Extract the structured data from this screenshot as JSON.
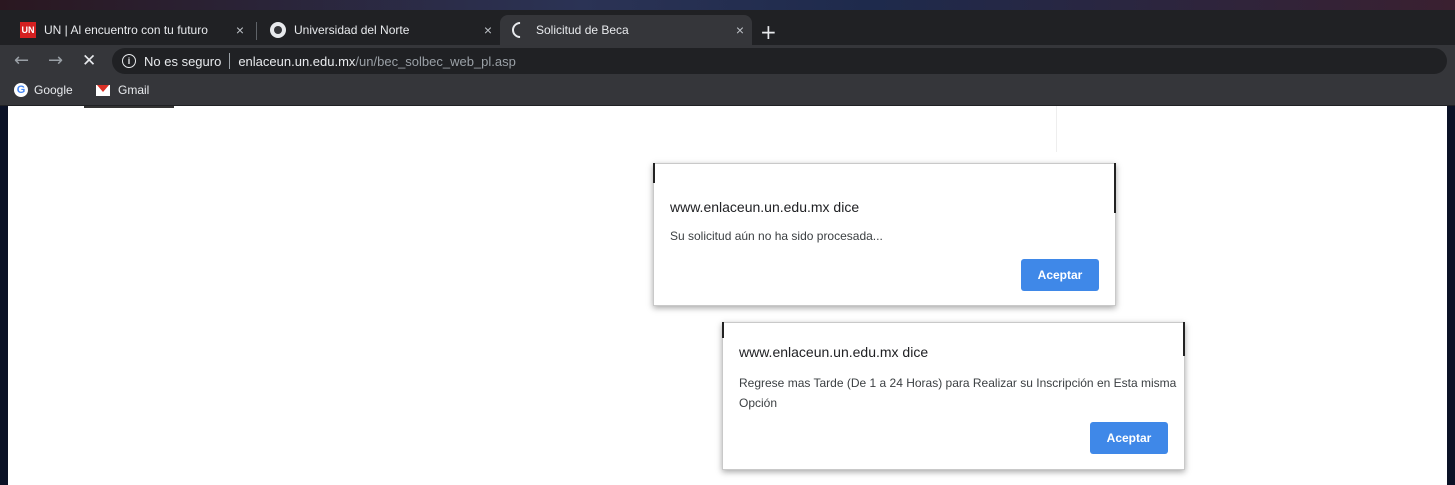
{
  "browser": {
    "tabs": [
      {
        "title": "UN | Al encuentro con tu futuro",
        "favicon": "university-red-icon",
        "active": false
      },
      {
        "title": "Universidad del Norte",
        "favicon": "globe-icon",
        "active": false
      },
      {
        "title": "Solicitud de Beca",
        "favicon": "loading-spinner-icon",
        "active": true
      }
    ],
    "close_glyph": "×",
    "new_tab_glyph": "+",
    "nav": {
      "back": "←",
      "forward": "→",
      "stop": "✕"
    },
    "address": {
      "security_icon": "i",
      "security_text": "No es seguro",
      "host": "enlaceun.un.edu.mx",
      "path": "/un/bec_solbec_web_pl.asp"
    },
    "bookmarks": [
      {
        "label": "Google",
        "icon": "google-icon"
      },
      {
        "label": "Gmail",
        "icon": "gmail-icon"
      }
    ]
  },
  "dialogs": [
    {
      "origin": "www.enlaceun.un.edu.mx dice",
      "message": "Su solicitud aún no ha sido procesada...",
      "button": "Aceptar"
    },
    {
      "origin": "www.enlaceun.un.edu.mx dice",
      "message": "Regrese mas Tarde (De 1 a 24 Horas) para Realizar su Inscripción en Esta misma Opción",
      "button": "Aceptar"
    }
  ],
  "colors": {
    "accent_button": "#3f88e8",
    "tabbar": "#202124",
    "toolbar": "#35363a"
  }
}
